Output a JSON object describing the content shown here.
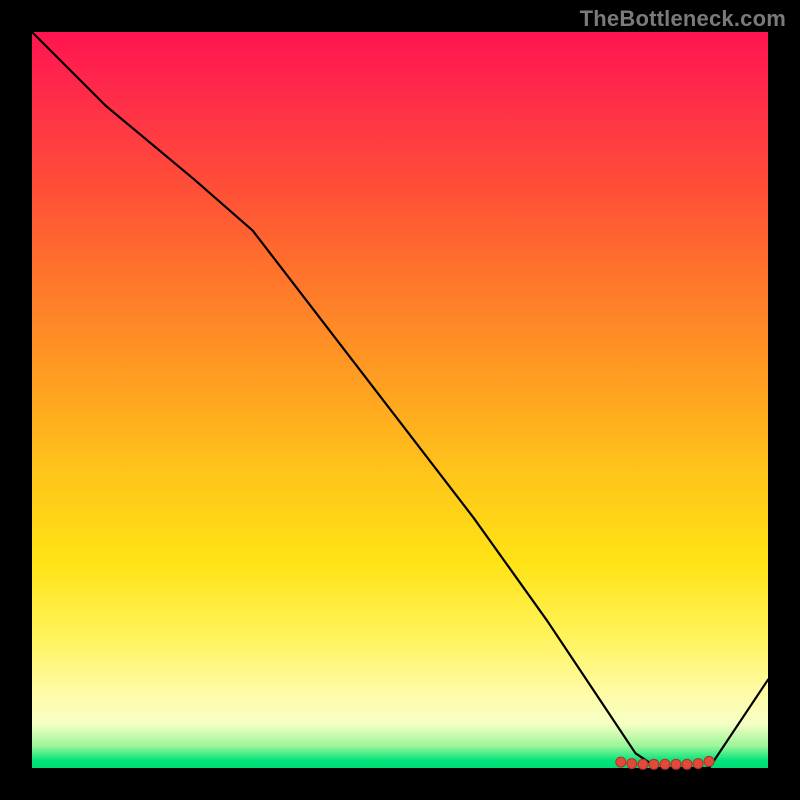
{
  "watermark": "TheBottleneck.com",
  "chart_data": {
    "type": "line",
    "title": "",
    "xlabel": "",
    "ylabel": "",
    "xlim": [
      0,
      100
    ],
    "ylim": [
      0,
      100
    ],
    "grid": false,
    "legend": null,
    "series": [
      {
        "name": "curve",
        "x": [
          0,
          10,
          22,
          30,
          40,
          50,
          60,
          70,
          78,
          82,
          85,
          88,
          90,
          92,
          100
        ],
        "y": [
          100,
          90,
          80,
          73,
          60,
          47,
          34,
          20,
          8,
          2,
          0,
          0,
          0,
          0,
          12
        ]
      }
    ],
    "markers": {
      "name": "bottom-cluster",
      "x": [
        80,
        81.5,
        83,
        84.5,
        86,
        87.5,
        89,
        90.5,
        92
      ],
      "y": [
        0.8,
        0.6,
        0.5,
        0.5,
        0.5,
        0.5,
        0.5,
        0.6,
        0.9
      ]
    },
    "background_gradient": {
      "top": "#ff1450",
      "mid_upper": "#ffa021",
      "mid_lower": "#fff35a",
      "bottom": "#00dd74"
    }
  }
}
